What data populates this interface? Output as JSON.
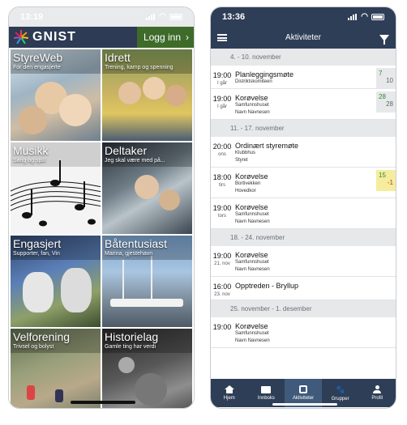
{
  "left": {
    "status": {
      "time": "13:19"
    },
    "brand": {
      "name": "GNIST"
    },
    "login_label": "Logg inn",
    "tiles": [
      {
        "title": "StyreWeb",
        "subtitle": "For den engasjerte"
      },
      {
        "title": "Idrett",
        "subtitle": "Trening, kamp og spenning"
      },
      {
        "title": "Musikk",
        "subtitle": "Sang og spill"
      },
      {
        "title": "Deltaker",
        "subtitle": "Jeg skal være med på..."
      },
      {
        "title": "Engasjert",
        "subtitle": "Supporter, fan, Vin"
      },
      {
        "title": "Båtentusiast",
        "subtitle": "Marina, gjestehavn"
      },
      {
        "title": "Velforening",
        "subtitle": "Trivsel og bolyst"
      },
      {
        "title": "Historielag",
        "subtitle": "Gamle ting har verdi"
      }
    ]
  },
  "right": {
    "status": {
      "time": "13:36"
    },
    "nav_title": "Aktiviteter",
    "weeks": [
      {
        "label": "4. - 10. november",
        "items": [
          {
            "time": "19:00",
            "day": "I går",
            "name": "Planleggingsmøte",
            "sub": [
              "Distriktskomiteen"
            ],
            "badge": {
              "top": "7",
              "bottom": "10",
              "top_color": "#2e8b2e",
              "bg": "#e7e8ea"
            }
          },
          {
            "time": "19:00",
            "day": "I går",
            "name": "Korøvelse",
            "sub": [
              "Samfunnshuset",
              "Navn Navnesen"
            ],
            "badge": {
              "top": "28",
              "bottom": "28",
              "top_color": "#2e8b2e",
              "bg": "#e7e8ea"
            }
          }
        ]
      },
      {
        "label": "11. - 17. november",
        "items": [
          {
            "time": "20:00",
            "day": "ons",
            "name": "Ordinært styremøte",
            "sub": [
              "Klubbhus",
              "Styret"
            ]
          },
          {
            "time": "18:00",
            "day": "tirs",
            "name": "Korøvelse",
            "sub": [
              "Bortivekken",
              "Hovedkor"
            ],
            "badge": {
              "top": "15",
              "bottom": "-1",
              "top_color": "#2e8b2e",
              "bottom_color": "#c0392b",
              "bg": "#f5ec9e"
            }
          },
          {
            "time": "19:00",
            "day": "tors",
            "name": "Korøvelse",
            "sub": [
              "Samfunnshuset",
              "Navn Navnesen"
            ]
          }
        ]
      },
      {
        "label": "18. - 24. november",
        "items": [
          {
            "time": "19:00",
            "day": "21. nov",
            "name": "Korøvelse",
            "sub": [
              "Samfunnshuset",
              "Navn Navnesen"
            ]
          },
          {
            "time": "16:00",
            "day": "23. nov",
            "name": "Opptreden - Bryllup",
            "sub": []
          }
        ]
      },
      {
        "label": "25. november - 1. desember",
        "items": [
          {
            "time": "19:00",
            "day": "",
            "name": "Korøvelse",
            "sub": [
              "Samfunnshuset",
              "Navn Navnesen"
            ]
          }
        ]
      }
    ],
    "tabs": [
      {
        "label": "Hjem",
        "icon": "home-icon"
      },
      {
        "label": "Innboks",
        "icon": "mail-icon"
      },
      {
        "label": "Aktiviteter",
        "icon": "calendar-icon",
        "active": true
      },
      {
        "label": "Grupper",
        "icon": "paw-icon"
      },
      {
        "label": "Profil",
        "icon": "user-icon"
      }
    ]
  }
}
